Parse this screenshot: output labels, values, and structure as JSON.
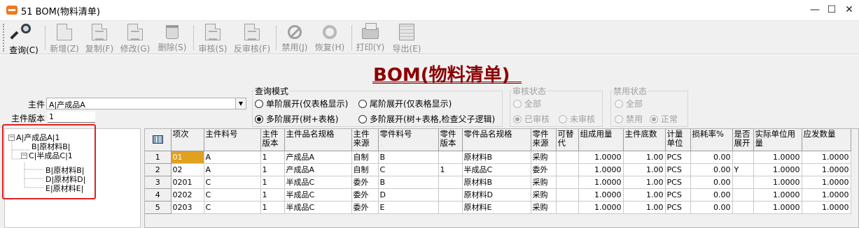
{
  "window": {
    "title": "51 BOM(物料清单)",
    "minimize": "—",
    "maximize": "☐",
    "close": "✕"
  },
  "toolbar": {
    "buttons": [
      {
        "label": "查询(C)",
        "icon": "query-icon",
        "enabled": true
      },
      {
        "label": "新增(Z)",
        "icon": "new-doc-icon",
        "enabled": false
      },
      {
        "label": "复制(F)",
        "icon": "copy-icon",
        "enabled": false
      },
      {
        "label": "修改(G)",
        "icon": "edit-icon",
        "enabled": false
      },
      {
        "label": "删除(S)",
        "icon": "trash-icon",
        "enabled": false
      },
      {
        "label": "审核(S)",
        "icon": "approve-icon",
        "enabled": false
      },
      {
        "label": "反审核(F)",
        "icon": "unapprove-icon",
        "enabled": false
      },
      {
        "label": "禁用(J)",
        "icon": "ban-icon",
        "enabled": false
      },
      {
        "label": "恢复(H)",
        "icon": "restore-icon",
        "enabled": false
      },
      {
        "label": "打印(Y)",
        "icon": "printer-icon",
        "enabled": false
      },
      {
        "label": "导出(E)",
        "icon": "export-icon",
        "enabled": false
      }
    ]
  },
  "form": {
    "title": "BOM(物料清单)",
    "main_item_label": "主件",
    "main_item_value": "A|产成品A",
    "main_version_label": "主件版本",
    "main_version_value": "1"
  },
  "query_mode": {
    "caption": "查询模式",
    "options": [
      {
        "label": "单阶展开(仅表格显示)",
        "checked": false
      },
      {
        "label": "尾阶展开(仅表格显示)",
        "checked": false
      },
      {
        "label": "多阶展开(树+表格)",
        "checked": true
      },
      {
        "label": "多阶展开(树+表格,检查父子逻辑)",
        "checked": false
      }
    ]
  },
  "audit_status": {
    "caption": "审核状态",
    "options": [
      {
        "label": "全部",
        "checked": false
      },
      {
        "label": "已审核",
        "checked": true
      },
      {
        "label": "未审核",
        "checked": false
      }
    ]
  },
  "disable_status": {
    "caption": "禁用状态",
    "options": [
      {
        "label": "全部",
        "checked": false
      },
      {
        "label": "禁用",
        "checked": false
      },
      {
        "label": "正常",
        "checked": true
      }
    ]
  },
  "tree": {
    "nodes": [
      {
        "label": "A|产成品A|1",
        "expander": "−"
      },
      {
        "label": "B|原材料B|",
        "expander": ""
      },
      {
        "label": "C|半成品C|1",
        "expander": "−"
      },
      {
        "label": "B|原材料B|",
        "expander": ""
      },
      {
        "label": "D|原材料D|",
        "expander": ""
      },
      {
        "label": "E|原材料E|",
        "expander": ""
      }
    ]
  },
  "grid": {
    "columns": [
      "项次",
      "主件料号",
      "主件版本",
      "主件品名规格",
      "主件来源",
      "零件料号",
      "零件版本",
      "零件品名规格",
      "零件来源",
      "可替代",
      "组成用量",
      "主件底数",
      "计量单位",
      "损耗率%",
      "是否展开",
      "实际单位用量",
      "应发数量"
    ],
    "rows": [
      {
        "no": "1",
        "cells": [
          "01",
          "A",
          "1",
          "产成品A",
          "自制",
          "B",
          "",
          "原材料B",
          "采购",
          "",
          "1.0000",
          "1.00",
          "PCS",
          "0.00",
          "",
          "1.0000",
          "1.0000"
        ]
      },
      {
        "no": "2",
        "cells": [
          "02",
          "A",
          "1",
          "产成品A",
          "自制",
          "C",
          "1",
          "半成品C",
          "委外",
          "",
          "1.0000",
          "1.00",
          "PCS",
          "0.00",
          "Y",
          "1.0000",
          "1.0000"
        ]
      },
      {
        "no": "3",
        "cells": [
          "0201",
          "C",
          "1",
          "半成品C",
          "委外",
          "B",
          "",
          "原材料B",
          "采购",
          "",
          "1.0000",
          "1.00",
          "PCS",
          "0.00",
          "",
          "1.0000",
          "1.0000"
        ]
      },
      {
        "no": "4",
        "cells": [
          "0202",
          "C",
          "1",
          "半成品C",
          "委外",
          "D",
          "",
          "原材料D",
          "采购",
          "",
          "1.0000",
          "1.00",
          "PCS",
          "0.00",
          "",
          "1.0000",
          "1.0000"
        ]
      },
      {
        "no": "5",
        "cells": [
          "0203",
          "C",
          "1",
          "半成品C",
          "委外",
          "E",
          "",
          "原材料E",
          "采购",
          "",
          "1.0000",
          "1.00",
          "PCS",
          "0.00",
          "",
          "1.0000",
          "1.0000"
        ]
      }
    ],
    "selected_cell": {
      "row": 0,
      "col": 0
    }
  },
  "colors": {
    "title": "#8b0000",
    "highlight_box": "#e02020",
    "selected_cell": "#e0a020"
  }
}
